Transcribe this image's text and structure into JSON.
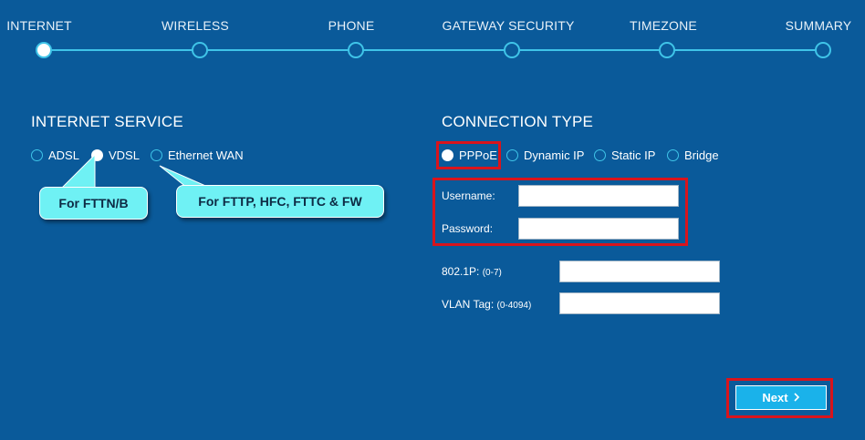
{
  "steps": [
    {
      "label": "INTERNET",
      "active": true
    },
    {
      "label": "WIRELESS",
      "active": false
    },
    {
      "label": "PHONE",
      "active": false
    },
    {
      "label": "GATEWAY SECURITY",
      "active": false
    },
    {
      "label": "TIMEZONE",
      "active": false
    },
    {
      "label": "SUMMARY",
      "active": false
    }
  ],
  "internet_service": {
    "title": "INTERNET SERVICE",
    "options": [
      "ADSL",
      "VDSL",
      "Ethernet WAN"
    ],
    "selected": "VDSL",
    "callouts": [
      "For FTTN/B",
      "For FTTP, HFC, FTTC & FW"
    ]
  },
  "connection_type": {
    "title": "CONNECTION TYPE",
    "options": [
      "PPPoE",
      "Dynamic IP",
      "Static IP",
      "Bridge"
    ],
    "selected": "PPPoE"
  },
  "fields": {
    "username_label": "Username:",
    "username_value": "",
    "password_label": "Password:",
    "password_value": "",
    "priority_label": "802.1P:",
    "priority_hint": "(0-7)",
    "priority_value": "",
    "vlan_label": "VLAN Tag:",
    "vlan_hint": "(0-4094)",
    "vlan_value": ""
  },
  "actions": {
    "next_label": "Next",
    "next_icon": "chevron-right-icon"
  },
  "colors": {
    "background": "#0a5a9a",
    "accent": "#3fc4e8",
    "callout": "#6ff1f4",
    "highlight": "#d9141c",
    "button": "#1ab2ea"
  }
}
